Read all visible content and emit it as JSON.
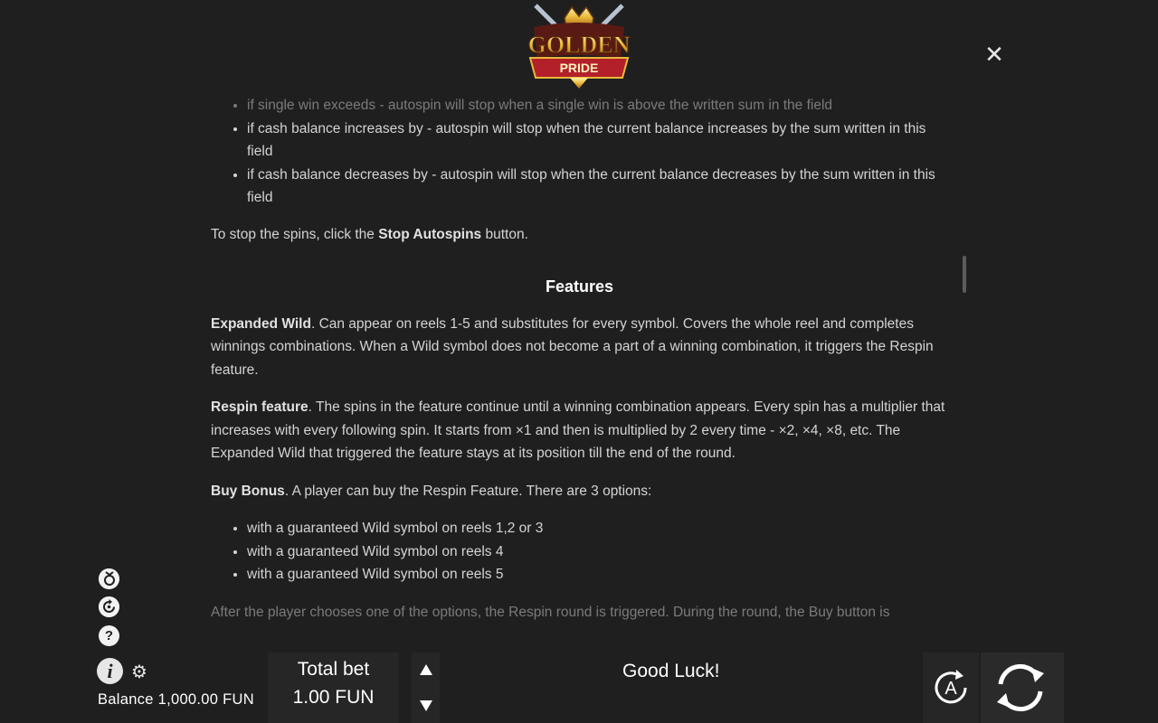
{
  "logo": {
    "line1": "GOLDEN",
    "line2": "PRIDE"
  },
  "close_label": "✕",
  "autospin_list": [
    "if single win exceeds - autospin will stop when a single win is above the written sum in the field",
    "if cash balance increases by - autospin will stop when the current balance increases by the sum written in this field",
    "if cash balance decreases by - autospin will stop when the current balance decreases by the sum written in this field"
  ],
  "stop_text": {
    "pre": "To stop the spins, click the ",
    "bold": "Stop Autospins",
    "post": " button."
  },
  "features_title": "Features",
  "expanded_wild": {
    "bold": "Expanded Wild",
    "text": ". Can appear on reels 1-5 and substitutes for every symbol. Covers the whole reel and completes winnings combinations. When a Wild symbol does not become a part of a winning combination, it triggers the Respin feature."
  },
  "respin": {
    "bold": "Respin feature",
    "text": ". The spins in the feature continue until a winning combination appears. Every spin has a multiplier that increases with every following spin. It starts from ×1 and then is multiplied by 2 every time - ×2, ×4, ×8, etc. The Expanded Wild that triggered the feature stays at its position till the end of the round."
  },
  "buy_bonus": {
    "bold": "Buy Bonus",
    "text": ". A player can buy the Respin Feature. There are 3 options:"
  },
  "buy_options": [
    "with a guaranteed Wild symbol on reels 1,2 or 3",
    "with a guaranteed Wild symbol on reels 4",
    "with a guaranteed Wild symbol on reels 5"
  ],
  "after_text": "After the player chooses one of the options, the Respin round is triggered. During the round, the Buy button is",
  "side_icons": [
    "buy-bonus-icon",
    "history-icon",
    "help-icon",
    "info-icon",
    "gear-icon"
  ],
  "help_label": "?",
  "info_label": "i",
  "gear_label": "⚙",
  "balance": "Balance 1,000.00 FUN",
  "bet": {
    "label": "Total bet",
    "value": "1.00 FUN"
  },
  "status": "Good Luck!",
  "autoplay_label": "A",
  "colors": {
    "background": "#1f1f1f",
    "panel": "#262626",
    "text": "#d4d4d4",
    "gold": "#e8b93a",
    "red": "#b3202a"
  }
}
